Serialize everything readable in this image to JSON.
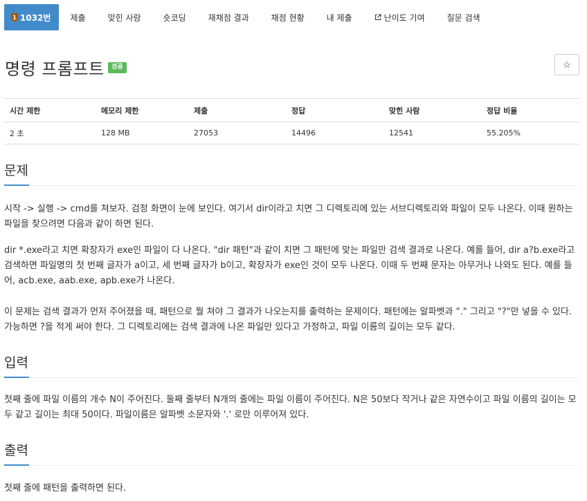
{
  "nav": {
    "problem_id": "1032번",
    "tier_digit": "1",
    "items": [
      "제출",
      "맞힌 사람",
      "숏코딩",
      "재채점 결과",
      "채점 현황",
      "내 제출",
      "난이도 기여",
      "질문 검색"
    ]
  },
  "title": {
    "text": "명령 프롬프트",
    "badge": "성공",
    "star": "☆"
  },
  "table": {
    "headers": [
      "시간 제한",
      "메모리 제한",
      "제출",
      "정답",
      "맞힌 사람",
      "정답 비율"
    ],
    "row": [
      "2 초",
      "128 MB",
      "27053",
      "14496",
      "12541",
      "55.205%"
    ]
  },
  "sections": {
    "problem": {
      "heading": "문제",
      "p1": "시작 -> 실행 -> cmd를 쳐보자. 검정 화면이 눈에 보인다. 여기서 dir이라고 치면 그 디렉토리에 있는 서브디렉토리와 파일이 모두 나온다. 이때 원하는 파일을 찾으려면 다음과 같이 하면 된다.",
      "p2": "dir *.exe라고 치면 확장자가 exe인 파일이 다 나온다. \"dir 패턴\"과 같이 치면 그 패턴에 맞는 파일만 검색 결과로 나온다. 예를 들어, dir a?b.exe라고 검색하면 파일명의 첫 번째 글자가 a이고, 세 번째 글자가 b이고, 확장자가 exe인 것이 모두 나온다. 이때 두 번째 문자는 아무거나 나와도 된다. 예를 들어, acb.exe, aab.exe, apb.exe가 나온다.",
      "p3": "이 문제는 검색 결과가 먼저 주어졌을 때, 패턴으로 뭘 쳐야 그 결과가 나오는지를 출력하는 문제이다. 패턴에는 알파벳과 \".\" 그리고 \"?\"만 넣을 수 있다. 가능하면 ?을 적게 써야 한다. 그 디렉토리에는 검색 결과에 나온 파일만 있다고 가정하고, 파일 이름의 길이는 모두 같다."
    },
    "input": {
      "heading": "입력",
      "p1": "첫째 줄에 파일 이름의 개수 N이 주어진다. 둘째 줄부터 N개의 줄에는 파일 이름이 주어진다. N은 50보다 작거나 같은 자연수이고 파일 이름의 길이는 모두 같고 길이는 최대 50이다. 파일이름은 알파벳 소문자와 '.' 로만 이루어져 있다."
    },
    "output": {
      "heading": "출력",
      "p1": "첫째 줄에 패턴을 출력하면 된다."
    }
  },
  "colors": {
    "primary": "#428bca",
    "success": "#5cb85c",
    "tier_bronze": "#ad5600"
  }
}
